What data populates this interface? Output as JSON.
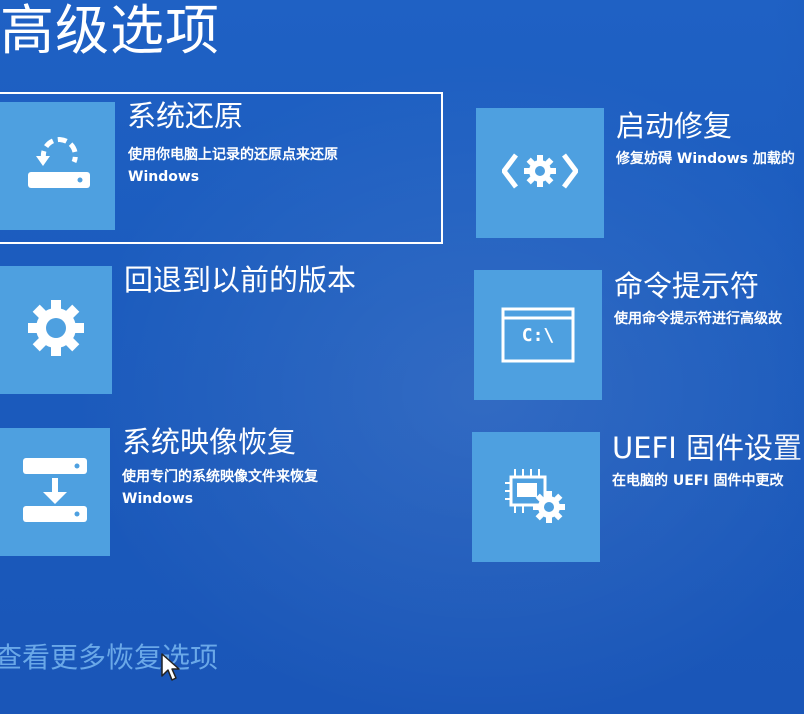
{
  "page": {
    "title": "高级选项",
    "more_options_link": "查看更多恢复选项"
  },
  "options": {
    "system_restore": {
      "title": "系统还原",
      "desc_line1": "使用你电脑上记录的还原点来还原",
      "desc_line2": "Windows",
      "icon": "restore-icon",
      "focused": true
    },
    "go_back": {
      "title": "回退到以前的版本",
      "icon": "gear-icon"
    },
    "image_recovery": {
      "title": "系统映像恢复",
      "desc_line1": "使用专门的系统映像文件来恢复",
      "desc_line2": "Windows",
      "icon": "image-restore-icon"
    },
    "startup_repair": {
      "title": "启动修复",
      "desc_line1": "修复妨碍 Windows 加载的",
      "icon": "code-gear-icon"
    },
    "command_prompt": {
      "title": "命令提示符",
      "desc_line1": "使用命令提示符进行高级故",
      "icon": "command-prompt-icon",
      "icon_text": "C:\\"
    },
    "uefi": {
      "title": "UEFI 固件设置",
      "desc_line1": "在电脑的 UEFI 固件中更改",
      "icon": "chip-gear-icon"
    }
  },
  "colors": {
    "background": "#1b5bbd",
    "tile": "#4ea0e0",
    "link": "#6aa8e8",
    "text": "#ffffff"
  }
}
